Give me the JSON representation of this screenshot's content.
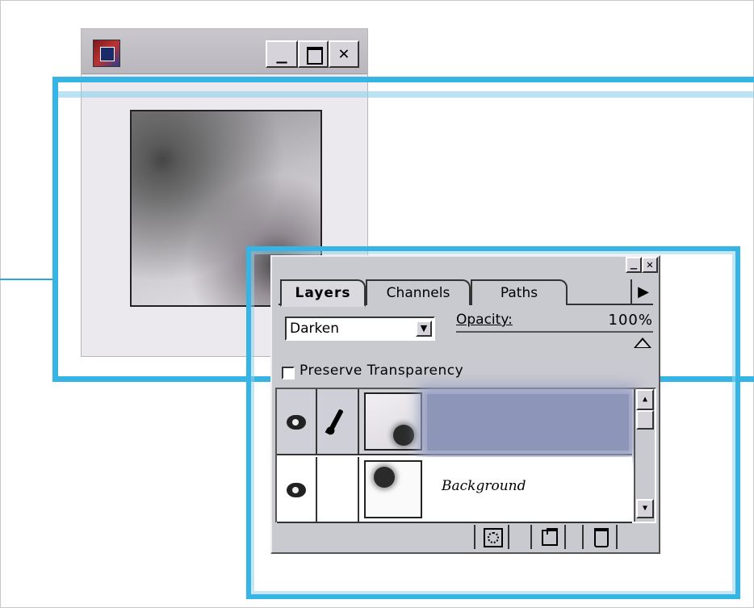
{
  "colors": {
    "callout": "#36b4e3",
    "palette_bg": "#c9c9d0",
    "selected_layer": "#8d95b8"
  },
  "doc_window": {
    "title": "",
    "buttons": {
      "minimize": "_",
      "maximize_icon": "maximize-icon",
      "close": "✕"
    }
  },
  "layers_palette": {
    "title_buttons": {
      "minimize": "_",
      "close": "✕"
    },
    "tabs": [
      {
        "label": "Layers",
        "active": true
      },
      {
        "label": "Channels",
        "active": false
      },
      {
        "label": "Paths",
        "active": false
      }
    ],
    "menu_arrow": "▶",
    "blend_mode": {
      "value": "Darken",
      "arrow": "▼"
    },
    "opacity": {
      "label": "Opacity:",
      "value": "100%",
      "level": 1.0
    },
    "preserve_transparency": {
      "label": "Preserve Transparency",
      "checked": false
    },
    "layers": [
      {
        "name": "",
        "visible": true,
        "brush": true,
        "selected": true
      },
      {
        "name": "Background",
        "visible": true,
        "brush": false,
        "selected": false
      }
    ],
    "scrollbar": {
      "up": "▲",
      "down": "▼"
    },
    "bottom_buttons": [
      {
        "icon": "layer-mask-icon"
      },
      {
        "icon": "new-layer-icon"
      },
      {
        "icon": "trash-icon"
      }
    ]
  }
}
